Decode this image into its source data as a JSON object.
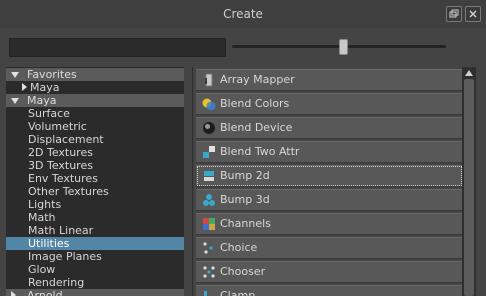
{
  "window": {
    "title": "Create"
  },
  "search": {
    "value": "",
    "placeholder": ""
  },
  "slider": {
    "level": 0.52
  },
  "tree": {
    "items": [
      {
        "label": "Favorites",
        "type": "header",
        "expanded": true
      },
      {
        "label": "Maya",
        "type": "child-collapsed"
      },
      {
        "label": "Maya",
        "type": "header",
        "expanded": true
      },
      {
        "label": "Surface",
        "type": "child"
      },
      {
        "label": "Volumetric",
        "type": "child"
      },
      {
        "label": "Displacement",
        "type": "child"
      },
      {
        "label": "2D Textures",
        "type": "child"
      },
      {
        "label": "3D Textures",
        "type": "child"
      },
      {
        "label": "Env Textures",
        "type": "child"
      },
      {
        "label": "Other Textures",
        "type": "child"
      },
      {
        "label": "Lights",
        "type": "child"
      },
      {
        "label": "Math",
        "type": "child"
      },
      {
        "label": "Math Linear",
        "type": "child"
      },
      {
        "label": "Utilities",
        "type": "child",
        "selected": true
      },
      {
        "label": "Image Planes",
        "type": "child"
      },
      {
        "label": "Glow",
        "type": "child"
      },
      {
        "label": "Rendering",
        "type": "child"
      },
      {
        "label": "Arnold",
        "type": "header",
        "expanded": false
      }
    ]
  },
  "nodes": {
    "items": [
      {
        "label": "Array Mapper",
        "icon": "array-mapper-icon"
      },
      {
        "label": "Blend Colors",
        "icon": "blend-colors-icon"
      },
      {
        "label": "Blend Device",
        "icon": "blend-device-icon"
      },
      {
        "label": "Blend Two Attr",
        "icon": "blend-two-attr-icon"
      },
      {
        "label": "Bump 2d",
        "icon": "bump-2d-icon",
        "focused": true
      },
      {
        "label": "Bump 3d",
        "icon": "bump-3d-icon"
      },
      {
        "label": "Channels",
        "icon": "channels-icon"
      },
      {
        "label": "Choice",
        "icon": "choice-icon"
      },
      {
        "label": "Chooser",
        "icon": "chooser-icon"
      },
      {
        "label": "Clamp",
        "icon": "clamp-icon"
      }
    ]
  },
  "colors": {
    "selection": "#5285a6",
    "tree_bg": "#2b2b2b",
    "node_bg": "#585858",
    "header_bg": "#5b5b5b"
  }
}
